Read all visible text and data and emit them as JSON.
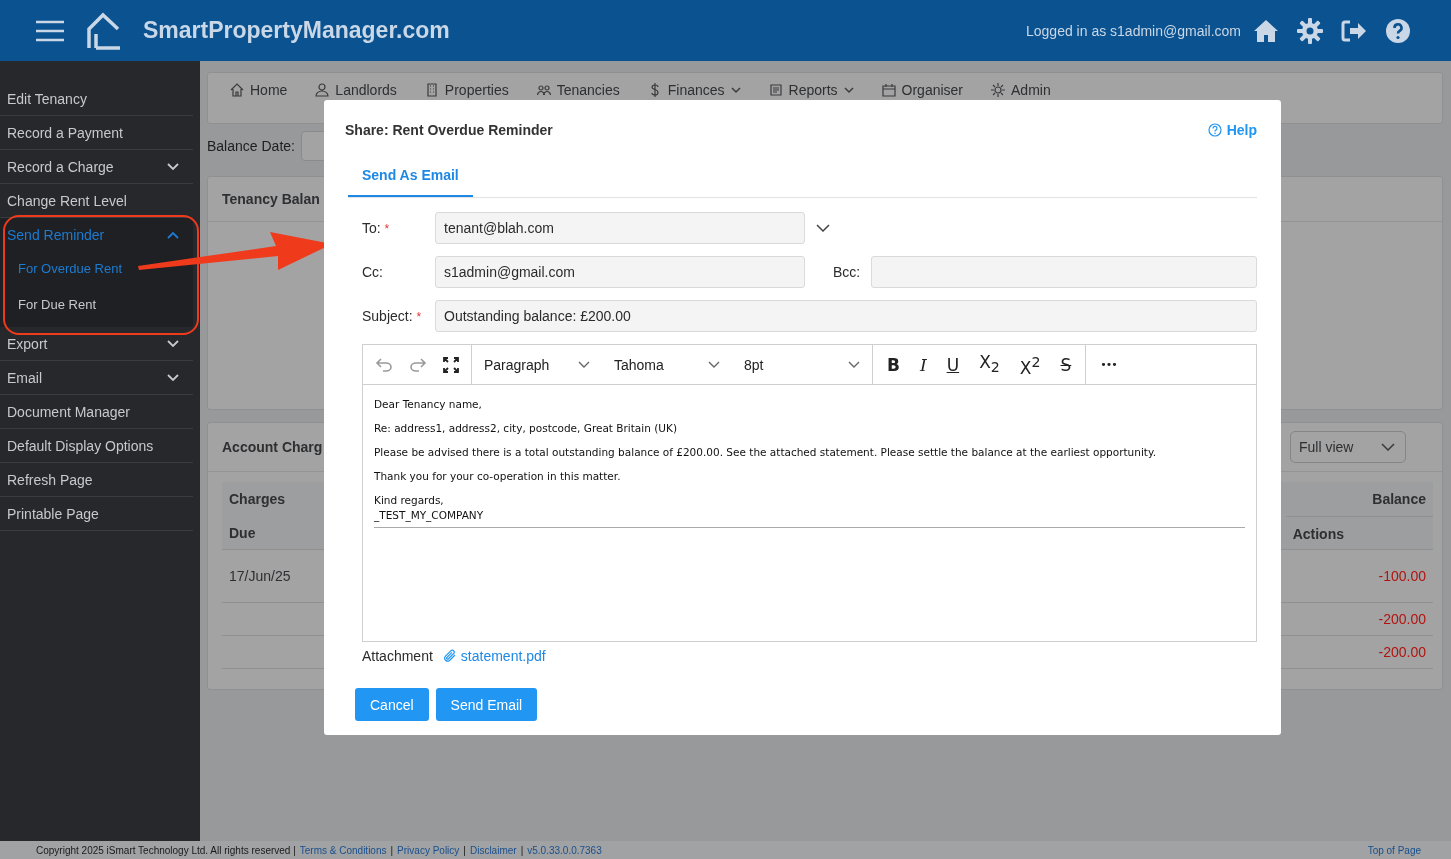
{
  "header": {
    "brand": "SmartPropertyManager.com",
    "user_text": "Logged in as s1admin@gmail.com"
  },
  "sidebar": {
    "items": [
      {
        "label": "Edit Tenancy",
        "selected": false,
        "kind": "link"
      },
      {
        "label": "Record a Payment",
        "selected": false,
        "kind": "link"
      },
      {
        "label": "Record a Charge",
        "selected": false,
        "kind": "group",
        "expanded": false
      },
      {
        "label": "Change Rent Level",
        "selected": false,
        "kind": "link"
      },
      {
        "label": "Send Reminder",
        "selected": true,
        "kind": "group",
        "expanded": true,
        "children": [
          {
            "label": "For Overdue Rent",
            "selected": true
          },
          {
            "label": "For Due Rent",
            "selected": false
          }
        ]
      },
      {
        "label": "Export",
        "selected": false,
        "kind": "group",
        "expanded": false
      },
      {
        "label": "Email",
        "selected": false,
        "kind": "group",
        "expanded": false
      },
      {
        "label": "Document Manager",
        "selected": false,
        "kind": "link"
      },
      {
        "label": "Default Display Options",
        "selected": false,
        "kind": "link"
      },
      {
        "label": "Refresh Page",
        "selected": false,
        "kind": "link"
      },
      {
        "label": "Printable Page",
        "selected": false,
        "kind": "link"
      }
    ]
  },
  "nav": [
    {
      "label": "Home",
      "kind": "link"
    },
    {
      "label": "Landlords",
      "kind": "link"
    },
    {
      "label": "Properties",
      "kind": "link"
    },
    {
      "label": "Tenancies",
      "kind": "link"
    },
    {
      "label": "Finances",
      "kind": "menu"
    },
    {
      "label": "Reports",
      "kind": "menu"
    },
    {
      "label": "Organiser",
      "kind": "link"
    },
    {
      "label": "Admin",
      "kind": "link"
    }
  ],
  "balance_date_label": "Balance Date:",
  "tenancy_card": {
    "title": "Tenancy Balan"
  },
  "account_card": {
    "title": "Account Charg",
    "view_select": "Full view",
    "table": {
      "left_headers": [
        "Charges",
        "Due"
      ],
      "right_headers": [
        "Balance",
        "Actions"
      ],
      "rows": [
        {
          "date": "17/Jun/25",
          "balance": "-100.00"
        },
        {
          "balance": "-200.00"
        },
        {
          "balance": "-200.00"
        }
      ]
    }
  },
  "modal": {
    "title": "Share: Rent Overdue Reminder",
    "help": "Help",
    "tabs": [
      {
        "label": "Send As Email",
        "selected": true
      }
    ],
    "to": {
      "label": "To:",
      "required_mark": "*",
      "value": "tenant@blah.com"
    },
    "cc": {
      "label": "Cc:",
      "value": "s1admin@gmail.com"
    },
    "bcc": {
      "label": "Bcc:"
    },
    "subject": {
      "label": "Subject:",
      "required_mark": "*",
      "value": "Outstanding balance: £200.00"
    },
    "toolbar": {
      "block": "Paragraph",
      "font": "Tahoma",
      "size": "8pt",
      "format_buttons": [
        {
          "kind": "bold",
          "text": "B"
        },
        {
          "kind": "italic",
          "text": "I"
        },
        {
          "kind": "underline",
          "text": "U"
        },
        {
          "kind": "subscript",
          "text": "X$_{2}$"
        },
        {
          "kind": "superscript",
          "text": "X$^{2}$"
        },
        {
          "kind": "strikethrough",
          "text": "S"
        }
      ],
      "more": "•••"
    },
    "body": [
      {
        "lines": [
          "Dear Tenancy name,"
        ]
      },
      {
        "lines": [
          "Re: address1, address2, city, postcode, Great Britain (UK)"
        ]
      },
      {
        "lines": [
          "Please be advised there is a total outstanding balance of £200.00. See the attached statement. Please settle the balance at the earliest opportunity."
        ]
      },
      {
        "lines": [
          "Thank you for your co-operation in this matter."
        ]
      },
      {
        "lines": [
          "Kind regards,",
          "_TEST_MY_COMPANY"
        ]
      }
    ],
    "attachment_label": "Attachment",
    "attachment_file": "statement.pdf",
    "buttons": [
      {
        "label": "Cancel"
      },
      {
        "label": "Send Email"
      }
    ]
  },
  "footer": {
    "copyright": "Copyright 2025 iSmart Technology Ltd. All rights reserved |",
    "links": [
      "Terms & Conditions",
      "Privacy Policy",
      "Disclaimer",
      "v5.0.33.0.0.7363"
    ],
    "separators": [
      "|",
      "|",
      "|"
    ],
    "top_link": "Top of Page"
  }
}
